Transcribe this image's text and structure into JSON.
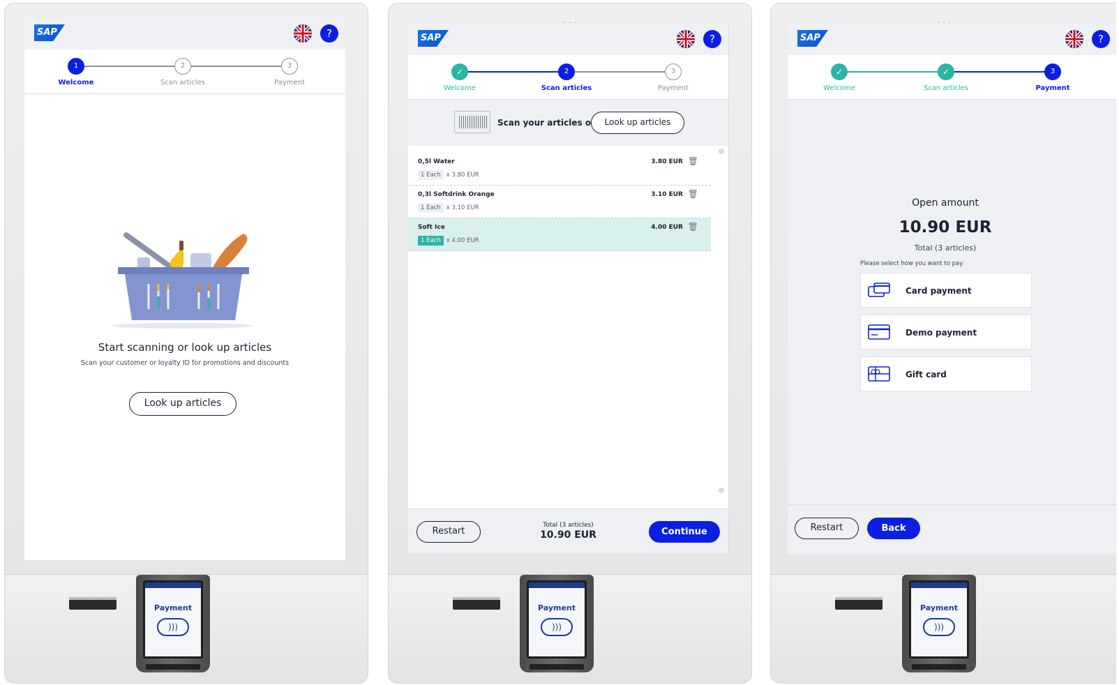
{
  "brand": {
    "logo_text": "SAP"
  },
  "header": {
    "help_label": "?"
  },
  "steps": {
    "labels": [
      "Welcome",
      "Scan articles",
      "Payment"
    ],
    "numbers": [
      "1",
      "2",
      "3"
    ],
    "done_mark": "✓"
  },
  "screen1": {
    "title": "Start scanning or look up articles",
    "subtitle": "Scan your customer or loyalty ID for promotions and discounts",
    "lookup_button": "Look up articles"
  },
  "screen2": {
    "scan_prompt": "Scan your articles or",
    "lookup_button": "Look up articles",
    "items": [
      {
        "name": "0,5l Water",
        "price": "3.80 EUR",
        "qty": "1 Each",
        "unit": "x 3.80 EUR",
        "selected": false
      },
      {
        "name": "0,3l Softdrink Orange",
        "price": "3.10 EUR",
        "qty": "1 Each",
        "unit": "x 3.10 EUR",
        "selected": false
      },
      {
        "name": "Soft Ice",
        "price": "4.00 EUR",
        "qty": "1 Each",
        "unit": "x 4.00 EUR",
        "selected": true
      }
    ],
    "restart_button": "Restart",
    "total_label": "Total (3 articles)",
    "total_value": "10.90 EUR",
    "continue_button": "Continue"
  },
  "screen3": {
    "title": "Open amount",
    "amount": "10.90 EUR",
    "total_label": "Total (3 articles)",
    "hint": "Please select how you want to pay",
    "options": [
      {
        "label": "Card payment",
        "icon": "card-payment-icon"
      },
      {
        "label": "Demo payment",
        "icon": "credit-card-icon"
      },
      {
        "label": "Gift card",
        "icon": "gift-card-icon"
      }
    ],
    "restart_button": "Restart",
    "back_button": "Back"
  },
  "terminal": {
    "label": "Payment"
  },
  "colors": {
    "primary": "#0b1fe0",
    "success": "#2bb5a2",
    "text": "#1c2233",
    "background": "#eef0f3"
  }
}
